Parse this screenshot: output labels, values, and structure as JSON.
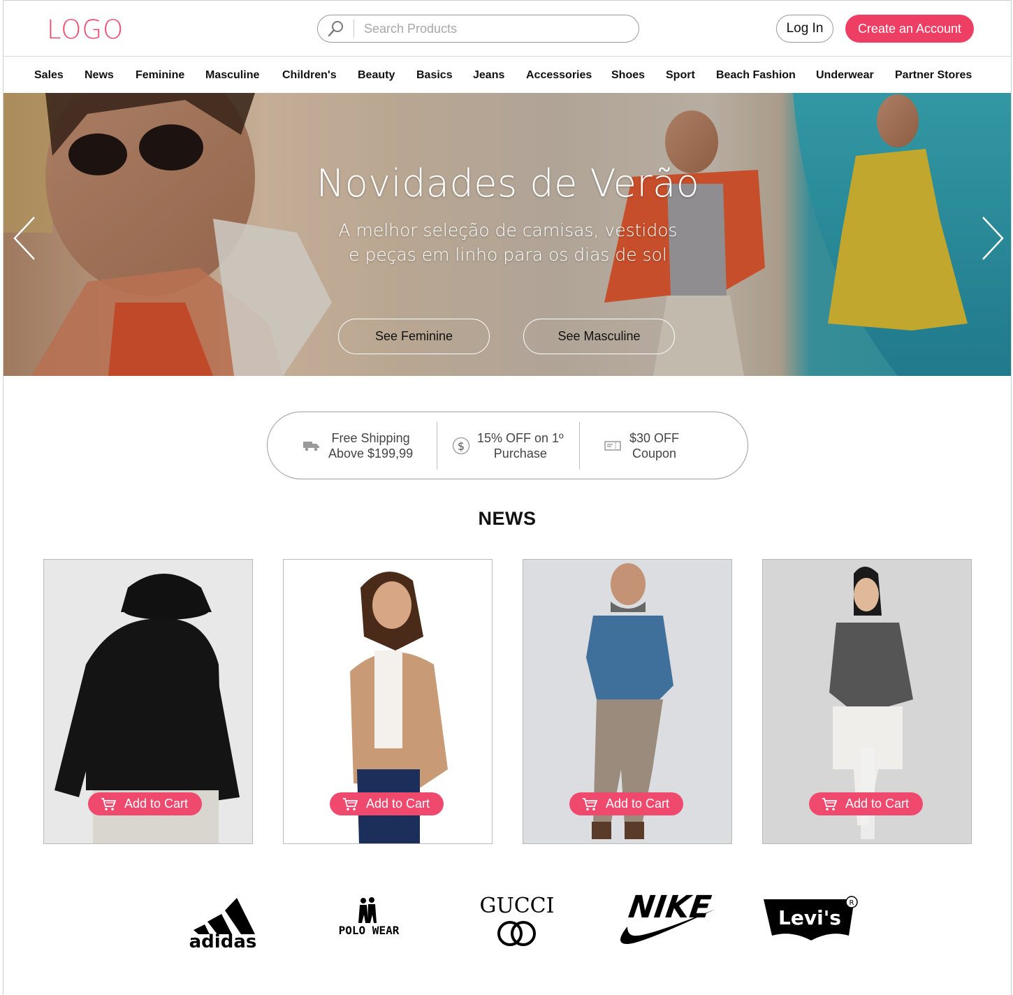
{
  "header": {
    "logo": "LOGO",
    "search_placeholder": "Search Products",
    "login_label": "Log In",
    "create_account_label": "Create an Account"
  },
  "nav": {
    "items": [
      "Sales",
      "News",
      "Feminine",
      "Masculine",
      "Children's",
      "Beauty",
      "Basics",
      "Jeans",
      "Accessories",
      "Shoes",
      "Sport",
      "Beach Fashion",
      "Underwear",
      "Partner Stores"
    ]
  },
  "hero": {
    "title": "Novidades de Verão",
    "subtitle_line1": "A melhor seleção de camisas, vestidos",
    "subtitle_line2": "e peças em linho para os dias de sol",
    "button_feminine": "See Feminine",
    "button_masculine": "See Masculine",
    "prev_icon": "chevron-left-icon",
    "next_icon": "chevron-right-icon"
  },
  "perks": [
    {
      "icon": "truck-icon",
      "line1": "Free Shipping",
      "line2": "Above $199,99"
    },
    {
      "icon": "dollar-icon",
      "line1": "15% OFF on 1º",
      "line2": "Purchase"
    },
    {
      "icon": "ticket-icon",
      "line1": "$30 OFF",
      "line2": "Coupon"
    }
  ],
  "news": {
    "title": "NEWS",
    "add_to_cart_label": "Add to Cart"
  },
  "brands": [
    "adidas",
    "POLO WEAR",
    "GUCCI",
    "NIKE",
    "Levi's"
  ],
  "colors": {
    "accent": "#ef3e63",
    "logo": "#ef4a6e",
    "text": "#111111"
  }
}
